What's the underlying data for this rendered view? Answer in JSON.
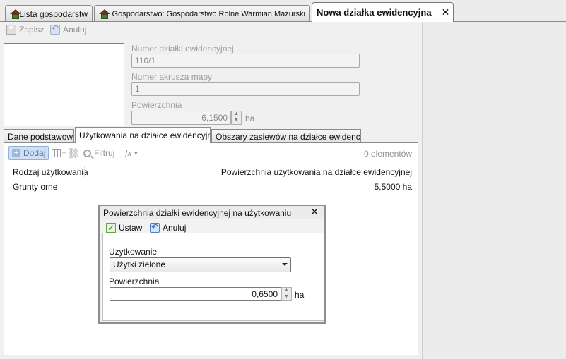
{
  "doc_tabs": [
    {
      "label": "Lista gospodarstw",
      "icon": "farm-house-icon"
    },
    {
      "label": "Gospodarstwo: Gospodarstwo Rolne Warmian Mazurski",
      "icon": "farm-house-icon"
    },
    {
      "label": "Nowa działka ewidencyjna",
      "active": true
    }
  ],
  "toolbar": {
    "save_label": "Zapisz",
    "cancel_label": "Anuluj"
  },
  "form": {
    "parcel_number_label": "Numer działki ewidencyjnej",
    "parcel_number_value": "110/1",
    "map_sheet_label": "Numer akrusza mapy",
    "map_sheet_value": "1",
    "area_label": "Powierzchnia",
    "area_value": "6,1500",
    "area_unit": "ha"
  },
  "inner_tabs": [
    {
      "label": "Dane podstawowe"
    },
    {
      "label": "Użytkowania na działce ewidencyjnej",
      "active": true
    },
    {
      "label": "Obszary zasiewów na działce ewidencyjnej"
    }
  ],
  "list_toolbar": {
    "add_label": "Dodaj",
    "filter_label": "Filtruj",
    "fx_label": "fx",
    "count_label": "0 elementów"
  },
  "grid": {
    "columns": [
      "Rodzaj użytkowania",
      "Powierzchnia użytkowania na działce ewidencyjnej"
    ],
    "rows": [
      [
        "Grunty orne",
        "5,5000 ha"
      ]
    ]
  },
  "dialog": {
    "title": "Powierzchnia działki ewidencyjnej na użytkowaniu",
    "set_label": "Ustaw",
    "cancel_label": "Anuluj",
    "usage_label": "Użytkowanie",
    "usage_value": "Użytki zielone",
    "area_label": "Powierzchnia",
    "area_value": "0,6500",
    "area_unit": "ha"
  },
  "colors": {
    "active_tab_bg": "#ffffff",
    "add_button_bg": "#cfe0f5",
    "check_green": "#2e8b1e",
    "undo_blue": "#2f60a8"
  }
}
